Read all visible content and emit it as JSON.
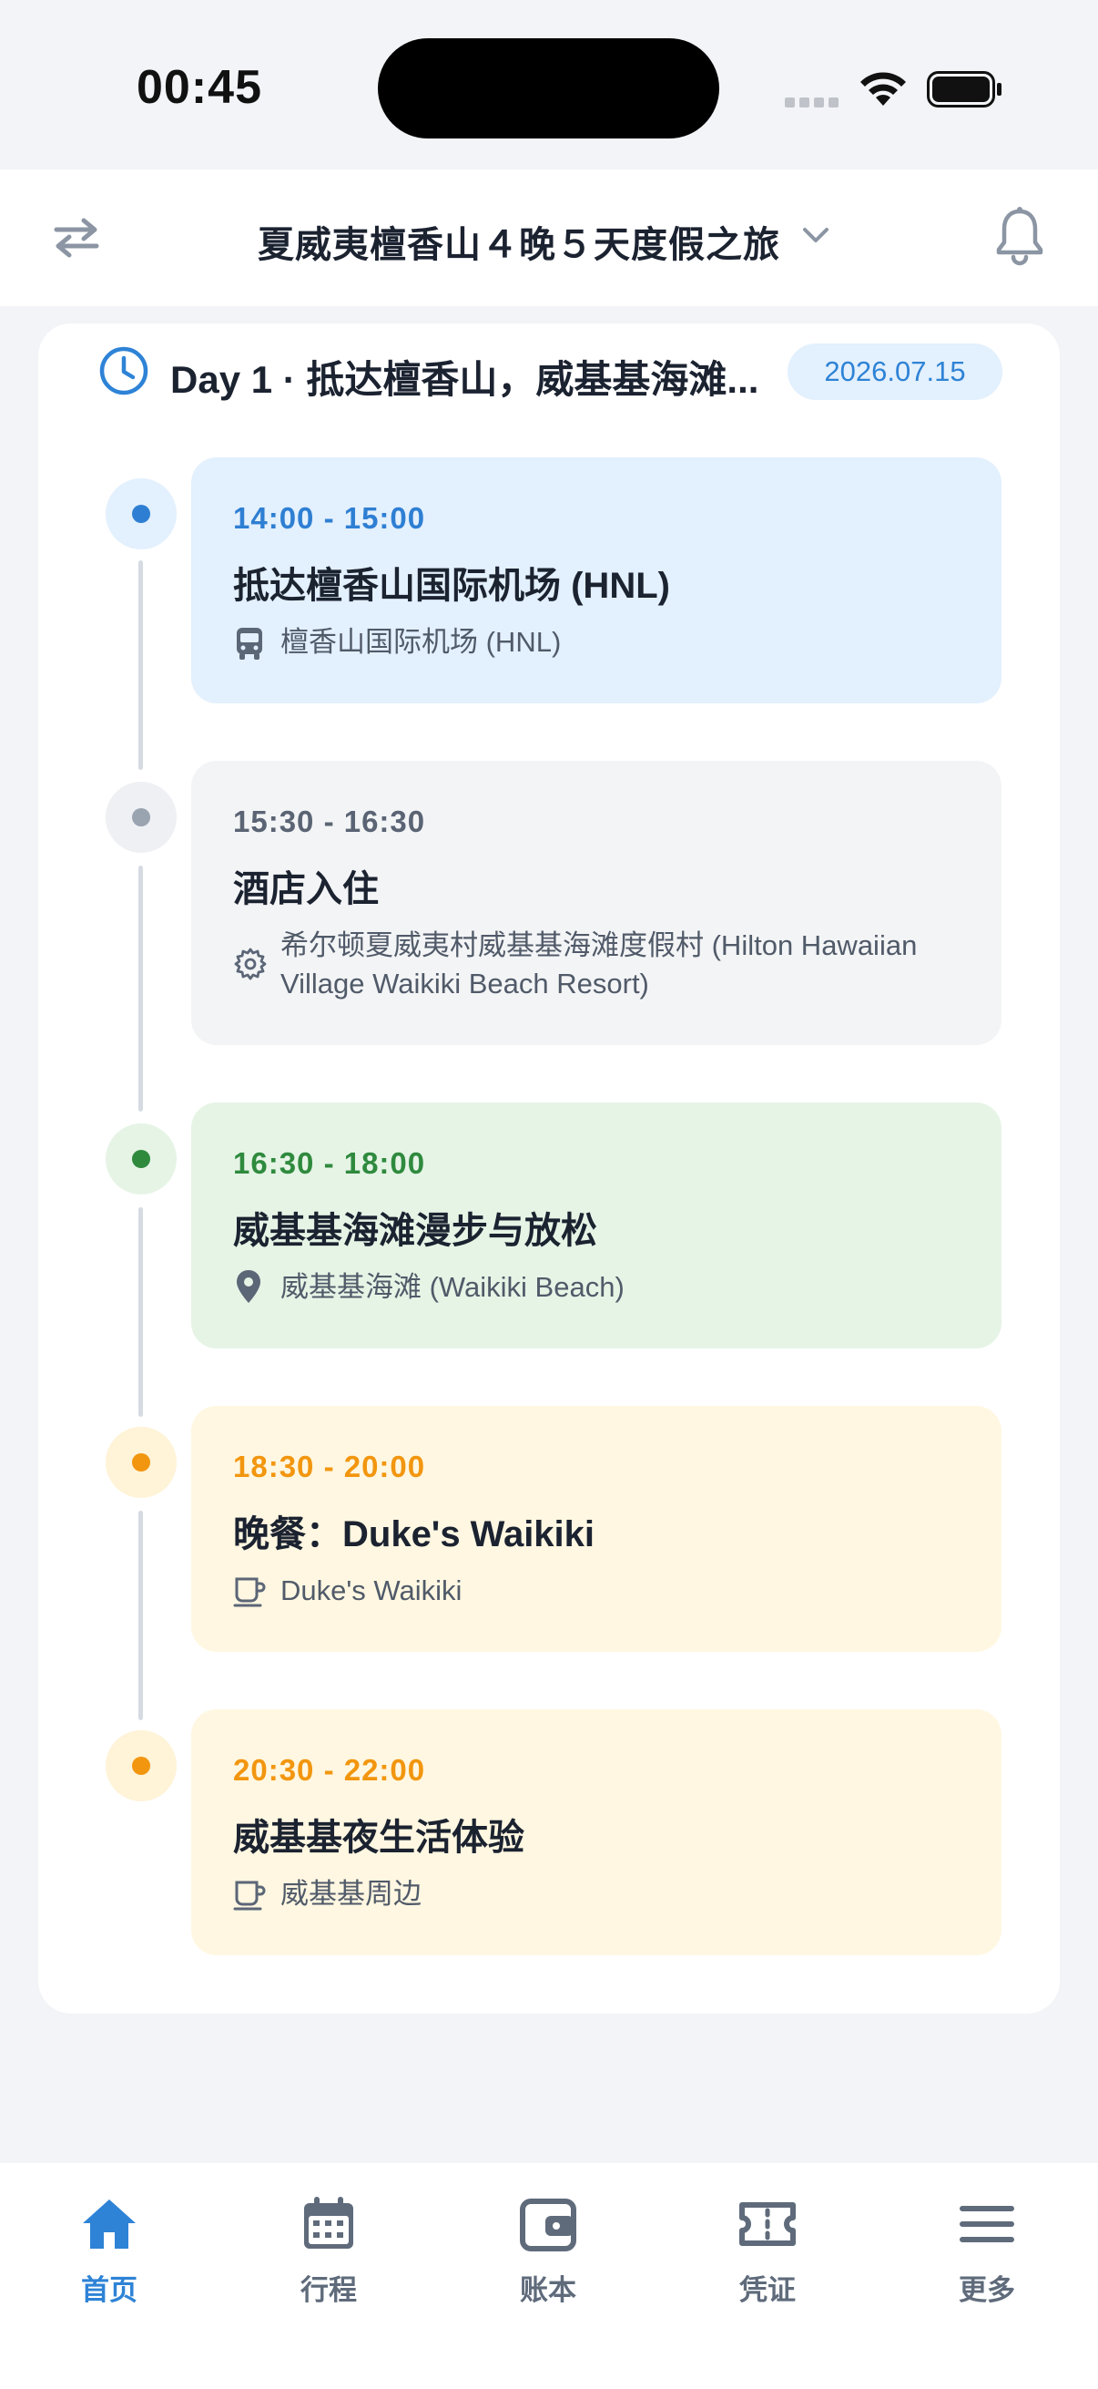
{
  "status": {
    "time": "00:45"
  },
  "header": {
    "trip_title": "夏威夷檀香山４晚５天度假之旅"
  },
  "day": {
    "title": "Day 1 · 抵达檀香山，威基基海滩...",
    "date": "2026.07.15"
  },
  "events": [
    {
      "time": "14:00 - 15:00",
      "title": "抵达檀香山国际机场 (HNL)",
      "location": "檀香山国际机场 (HNL)",
      "icon": "bus-icon",
      "bg": "#e3f0fd",
      "accent": "#2e7fd3"
    },
    {
      "time": "15:30 - 16:30",
      "title": "酒店入住",
      "location": "希尔顿夏威夷村威基基海滩度假村 (Hilton Hawaiian Village Waikiki Beach Resort)",
      "icon": "gear-icon",
      "bg": "#f3f4f5",
      "accent": "#5a6474"
    },
    {
      "time": "16:30 - 18:00",
      "title": "威基基海滩漫步与放松",
      "location": "威基基海滩 (Waikiki Beach)",
      "icon": "map-pin-icon",
      "bg": "#e6f4e6",
      "accent": "#2f8a3e"
    },
    {
      "time": "18:30 - 20:00",
      "title": "晚餐：Duke's Waikiki",
      "location": "Duke's Waikiki",
      "icon": "coffee-cup-icon",
      "bg": "#fff7e1",
      "accent": "#f2960f"
    },
    {
      "time": "20:30 - 22:00",
      "title": "威基基夜生活体验",
      "location": "威基基周边",
      "icon": "coffee-cup-icon",
      "bg": "#fff7e1",
      "accent": "#f2960f"
    }
  ],
  "tabs": [
    {
      "label": "首页",
      "icon": "home-icon",
      "active": true
    },
    {
      "label": "行程",
      "icon": "calendar-icon",
      "active": false
    },
    {
      "label": "账本",
      "icon": "wallet-icon",
      "active": false
    },
    {
      "label": "凭证",
      "icon": "ticket-icon",
      "active": false
    },
    {
      "label": "更多",
      "icon": "menu-icon",
      "active": false
    }
  ],
  "colors": {
    "accent": "#2e83d6",
    "inactive": "#5f6b7b",
    "background": "#f2f4f7"
  }
}
